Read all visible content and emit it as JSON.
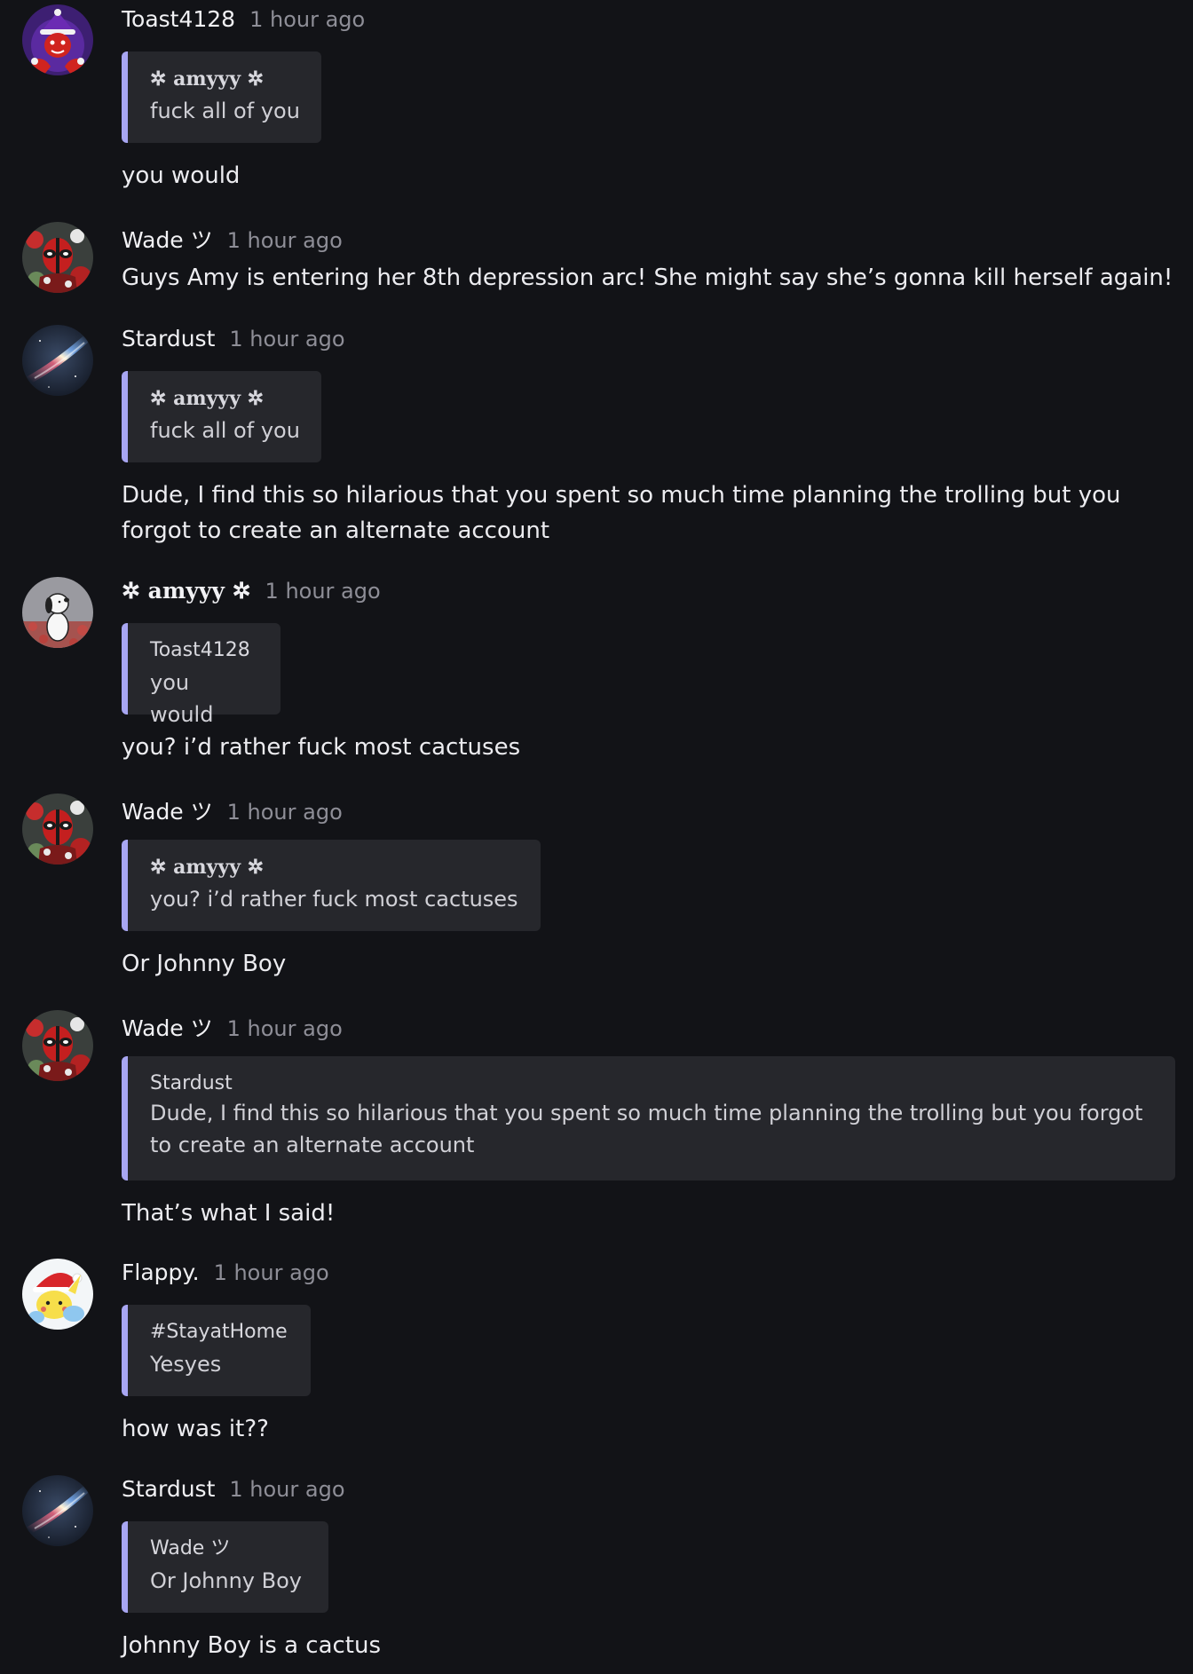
{
  "messages": [
    {
      "author": "Toast4128",
      "time": "1 hour ago",
      "quote_author": "✲ amyyy ✲",
      "quote_text": "fuck all of you",
      "text": "you would",
      "avatar": "red-devil-avatar"
    },
    {
      "author": "Wade ツ",
      "time": "1 hour ago",
      "text": "Guys Amy is entering her 8th depression arc! She might say she’s gonna kill herself again!",
      "avatar": "deadpool-avatar"
    },
    {
      "author": "Stardust",
      "time": "1 hour ago",
      "quote_author": "✲ amyyy ✲",
      "quote_text": "fuck all of you",
      "text": "Dude, I find this so hilarious that you spent so much time planning the trolling but you forgot to create an alternate account",
      "avatar": "galaxy-avatar"
    },
    {
      "author": "✲ amyyy ✲",
      "time": "1 hour ago",
      "quote_author": "Toast4128",
      "quote_text": "you would",
      "text": "you? i’d rather fuck most cactuses",
      "avatar": "snoopy-avatar"
    },
    {
      "author": "Wade ツ",
      "time": "1 hour ago",
      "quote_author": "✲ amyyy ✲",
      "quote_text": "you? i’d rather fuck most cactuses",
      "text": "Or Johnny Boy",
      "avatar": "deadpool-avatar"
    },
    {
      "author": "Wade ツ",
      "time": "1 hour ago",
      "quote_author": "Stardust",
      "quote_text": "Dude, I find this so hilarious that you spent so much time planning the trolling but you forgot to create an alternate account",
      "text": "That’s what I said!",
      "avatar": "deadpool-avatar"
    },
    {
      "author": "Flappy.",
      "time": "1 hour ago",
      "quote_author": "#StayatHome",
      "quote_text": "Yesyes",
      "text": "how was it??",
      "avatar": "pikachu-santa-avatar"
    },
    {
      "author": "Stardust",
      "time": "1 hour ago",
      "quote_author": "Wade ツ",
      "quote_text": "Or Johnny Boy",
      "text": "Johnny Boy is a cactus",
      "avatar": "galaxy-avatar"
    }
  ],
  "colors": {
    "background": "#121317",
    "quote_background": "#26272c",
    "quote_accent": "#a8a6f2",
    "timestamp": "#8e8e97"
  }
}
